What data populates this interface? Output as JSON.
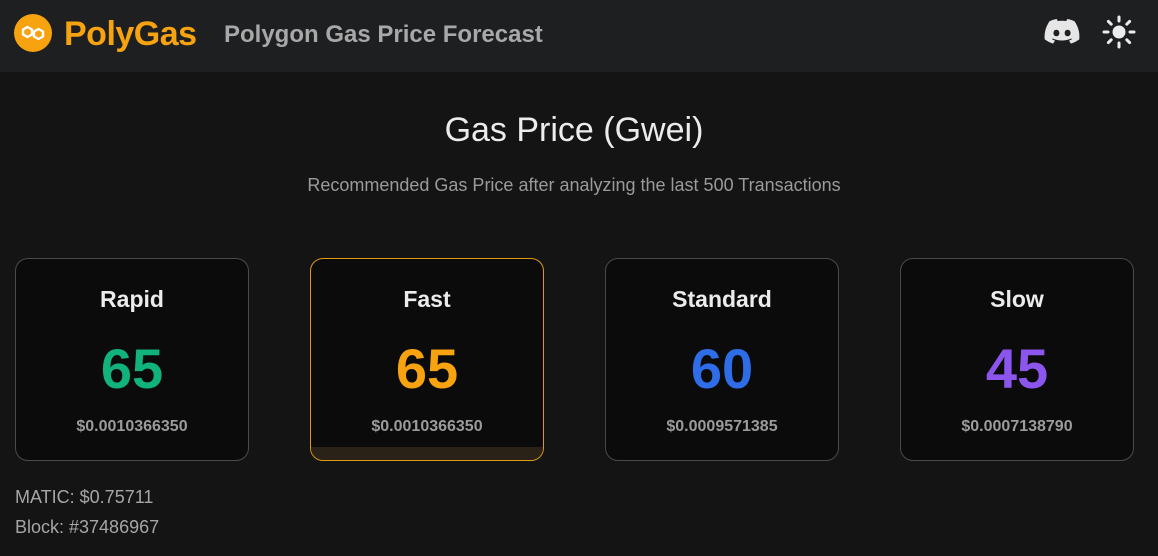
{
  "header": {
    "brand": "PolyGas",
    "subtitle": "Polygon Gas Price Forecast",
    "logo_icon": "polygon-logo-icon",
    "discord_icon": "discord-icon",
    "theme_icon": "sun-icon"
  },
  "main": {
    "title": "Gas Price (Gwei)",
    "description": "Recommended Gas Price after analyzing the last 500 Transactions"
  },
  "cards": [
    {
      "label": "Rapid",
      "value": "65",
      "usd": "$0.0010366350",
      "color": "#12b27c",
      "active": false
    },
    {
      "label": "Fast",
      "value": "65",
      "usd": "$0.0010366350",
      "color": "#f6a30f",
      "active": true
    },
    {
      "label": "Standard",
      "value": "60",
      "usd": "$0.0009571385",
      "color": "#2f6de8",
      "active": false
    },
    {
      "label": "Slow",
      "value": "45",
      "usd": "$0.0007138790",
      "color": "#8b55ee",
      "active": false
    }
  ],
  "footer": {
    "matic": "MATIC: $0.75711",
    "block": "Block: #37486967"
  },
  "colors": {
    "accent": "#f6a30f",
    "background": "#141414",
    "header_bg": "#1e1f21"
  }
}
